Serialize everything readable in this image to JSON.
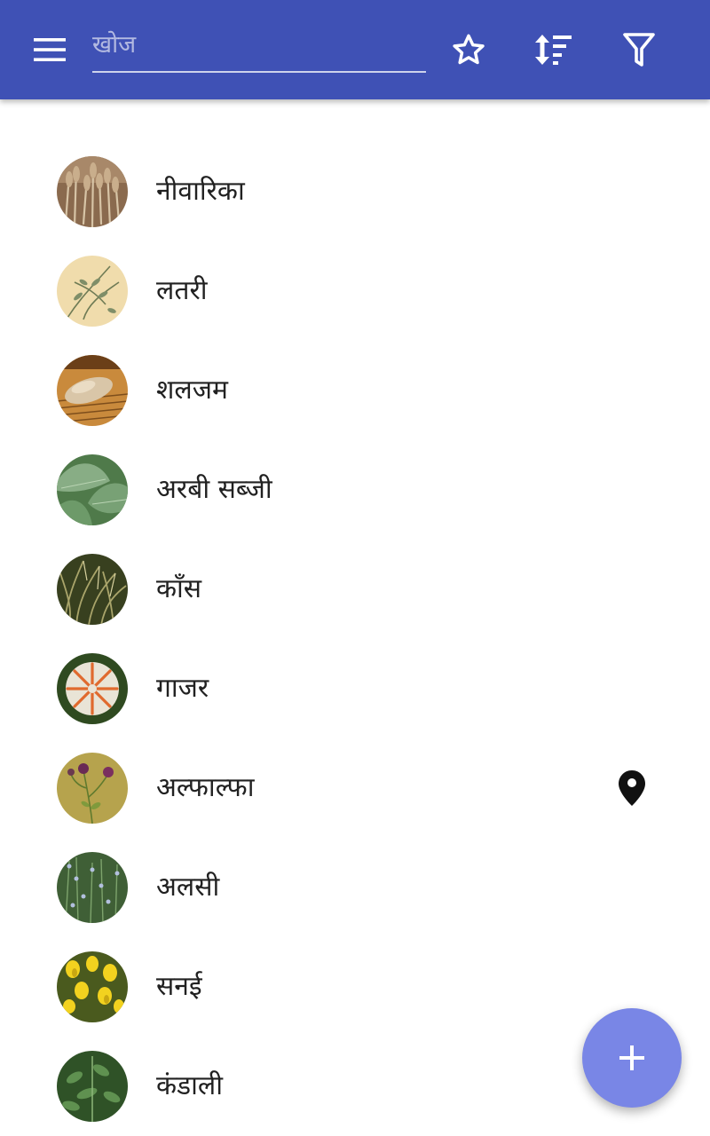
{
  "toolbar": {
    "menu_icon": "hamburger-menu-icon",
    "search_placeholder": "खोज",
    "search_value": "",
    "favorite_icon": "star-outline-icon",
    "sort_icon": "sort-icon",
    "filter_icon": "filter-icon",
    "bar_color": "#3f51b5"
  },
  "plants": [
    {
      "label": "नीवारिका",
      "thumb": "wheat-field"
    },
    {
      "label": "लतरी",
      "thumb": "vetch-illustration"
    },
    {
      "label": "शलजम",
      "thumb": "turnip"
    },
    {
      "label": "अरबी सब्जी",
      "thumb": "taro-leaves"
    },
    {
      "label": "काँस",
      "thumb": "kans-grass"
    },
    {
      "label": "गाजर",
      "thumb": "carrots"
    },
    {
      "label": "अल्फाल्फा",
      "thumb": "alfalfa-flowers",
      "has_location": true,
      "location_icon": "map-pin-icon"
    },
    {
      "label": "अलसी",
      "thumb": "flax-plants"
    },
    {
      "label": "सनई",
      "thumb": "sunn-hemp-flowers"
    },
    {
      "label": "कंडाली",
      "thumb": "nettle-plant"
    }
  ],
  "fab": {
    "icon": "plus-icon",
    "color": "#7986e6"
  }
}
